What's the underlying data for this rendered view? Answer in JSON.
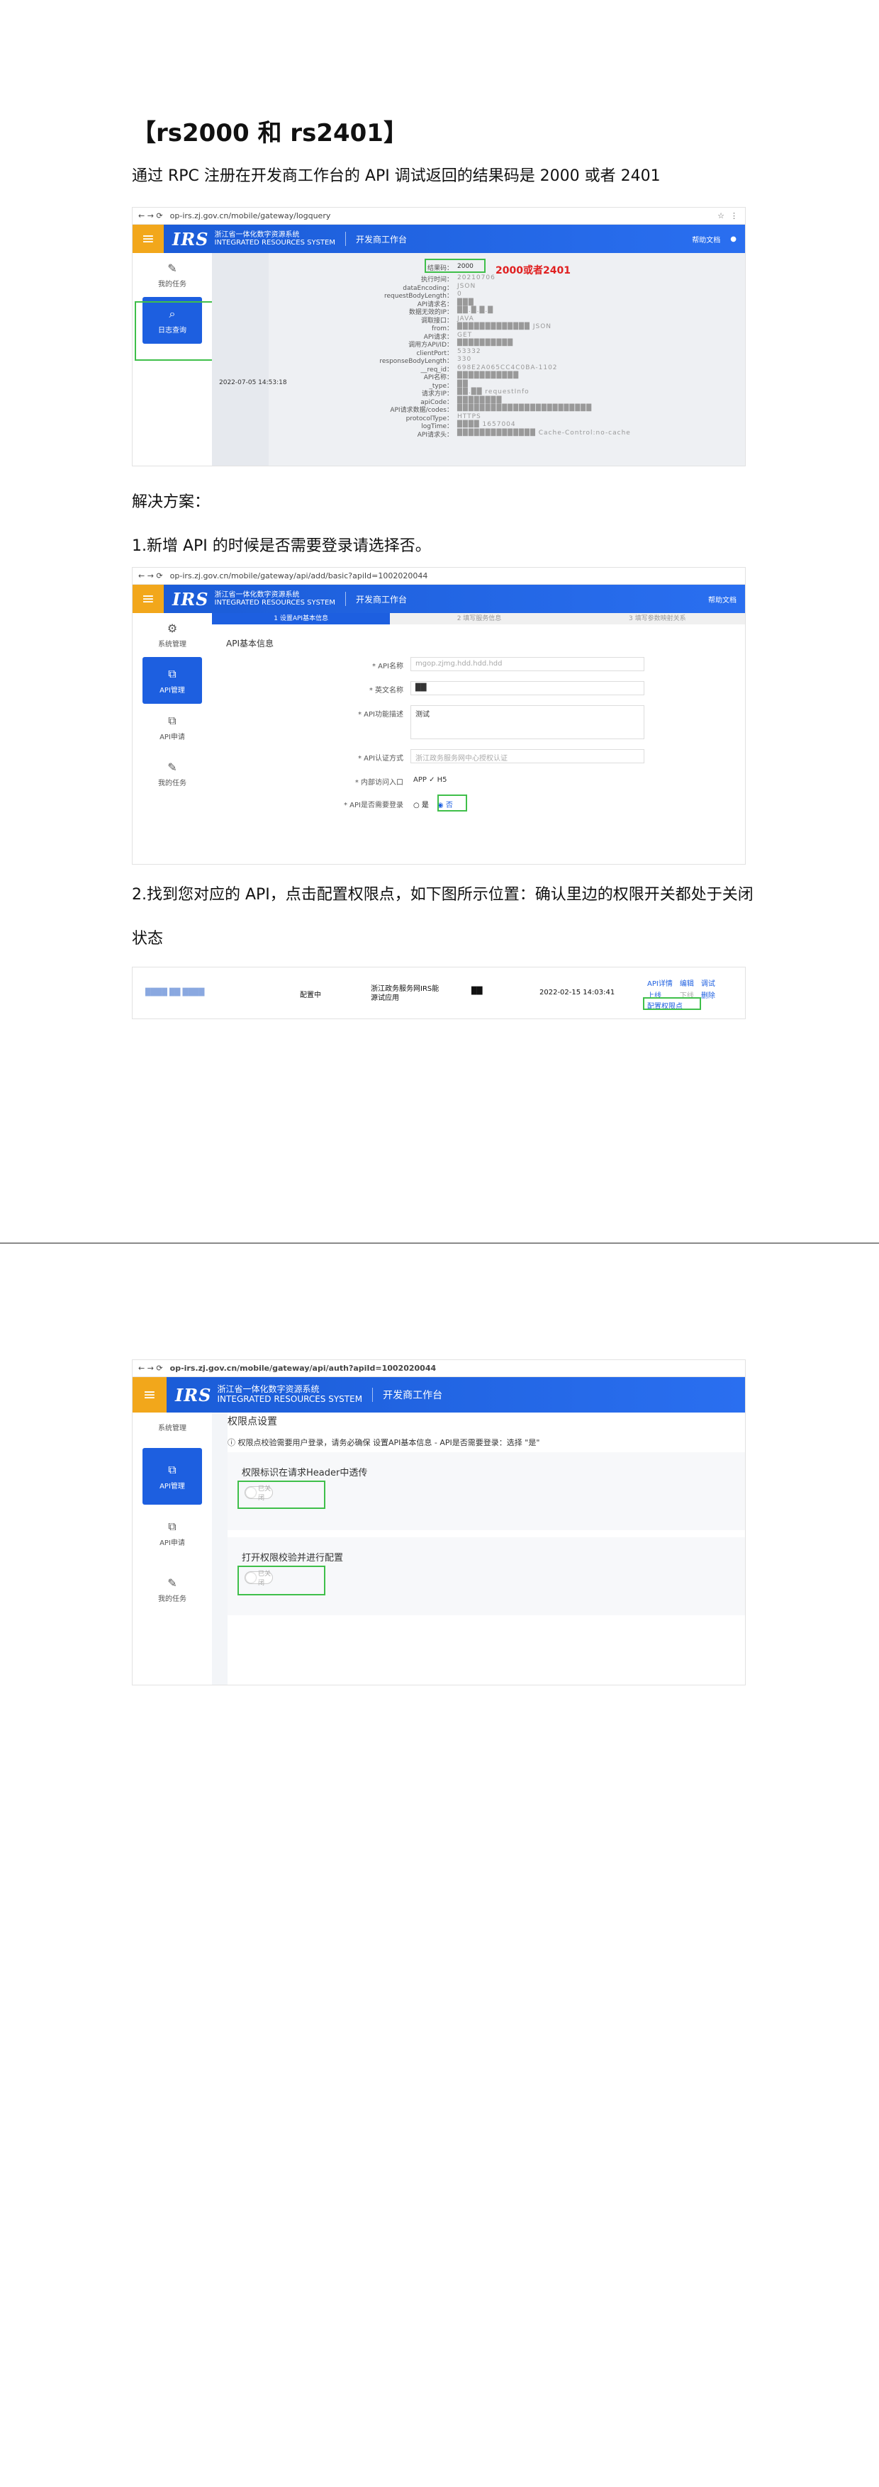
{
  "title": "【rs2000 和 rs2401】",
  "intro": "通过 RPC 注册在开发商工作台的 API  调试返回的结果码是 2000 或者 2401",
  "solution_heading": "解决方案：",
  "step1": "1.新增 API 的时候是否需要登录请选择否。",
  "step2_line1": "2.找到您对应的 API，点击配置权限点，如下图所示位置：确认里边的权限开关都处于关闭",
  "step2_line2": "状态",
  "app": {
    "logo": "IRS",
    "logo_cn": "浙江省一体化数字资源系统",
    "logo_en": "INTEGRATED RESOURCES SYSTEM",
    "name": "开发商工作台",
    "help": "帮助文档"
  },
  "shot1": {
    "url": "op-irs.zj.gov.cn/mobile/gateway/logquery",
    "side_items": [
      "我的任务",
      "日志查询"
    ],
    "annotation": "2000或者2401",
    "result_code_label": "结果码：",
    "result_code": "2000",
    "time": "2022-07-05 14:53:18",
    "rows": [
      {
        "k": "执行时间：",
        "v": "20210706"
      },
      {
        "k": "dataEncoding：",
        "v": "JSON"
      },
      {
        "k": "requestBodyLength：",
        "v": "0"
      },
      {
        "k": "API请求名：",
        "v": "███"
      },
      {
        "k": "数据无效的IP：",
        "v": "██.█.█.█"
      },
      {
        "k": "调取接口：",
        "v": "JAVA"
      },
      {
        "k": "from：",
        "v": "█████████████ JSON"
      },
      {
        "k": "API请求：",
        "v": "GET"
      },
      {
        "k": "调用方API/ID：",
        "v": "██████████"
      },
      {
        "k": "clientPort：",
        "v": "53332"
      },
      {
        "k": "responseBodyLength：",
        "v": "330"
      },
      {
        "k": "__req_id：",
        "v": "698E2A065CC4C0BA-1102"
      },
      {
        "k": "API名称：",
        "v": "███████████"
      },
      {
        "k": "_type：",
        "v": "██"
      },
      {
        "k": "请求方IP：",
        "v": "██.██  requestInfo"
      },
      {
        "k": "apiCode：",
        "v": "████████"
      },
      {
        "k": "API请求数据/codes：",
        "v": "████████████████████████"
      },
      {
        "k": "protocolType：",
        "v": "HTTPS"
      },
      {
        "k": "logTime：",
        "v": "████ 1657004"
      },
      {
        "k": "API请求头：",
        "v": "██████████████ Cache-Control:no-cache"
      }
    ]
  },
  "shot2": {
    "url": "op-irs.zj.gov.cn/mobile/gateway/api/add/basic?apiId=1002020044",
    "steps": [
      "1 设置API基本信息",
      "2 填写服务信息",
      "3 填写参数映射关系"
    ],
    "side_items": [
      "系统管理",
      "API管理",
      "API申请",
      "我的任务"
    ],
    "section": "API基本信息",
    "fields": [
      {
        "label": "* API名称",
        "value": "",
        "placeholder": "mgop.zjmg.hdd.hdd.hdd"
      },
      {
        "label": "* 英文名称",
        "value": "██",
        "placeholder": ""
      },
      {
        "label": "* API功能描述",
        "value": "测试",
        "placeholder": ""
      },
      {
        "label": "* API认证方式",
        "value": "",
        "placeholder": "浙江政务服务网中心授权认证"
      },
      {
        "label": "* 内部访问入口",
        "value": "APP  ✓ H5",
        "placeholder": ""
      },
      {
        "label": "* API是否需要登录",
        "value": "",
        "placeholder": ""
      }
    ],
    "login_options": [
      "是",
      "否"
    ]
  },
  "shot3": {
    "row_name": "████ ██ ████",
    "status": "配置中",
    "org": "浙江政务服务网IRS能源试应用",
    "time": "2022-02-15 14:03:41",
    "actions": [
      "API详情",
      "编辑",
      "调试",
      "上线",
      "下线",
      "删除"
    ],
    "config_link": "配置权限点"
  },
  "shot4": {
    "url": "op-irs.zj.gov.cn/mobile/gateway/api/auth?apiId=1002020044",
    "side_items": [
      "系统管理",
      "API管理",
      "API申请",
      "我的任务"
    ],
    "title": "权限点设置",
    "notice": "权限点校验需要用户登录，请务必确保 设置API基本信息 - API是否需要登录：选择 \"是\"",
    "section1": "权限标识在请求Header中透传",
    "section2": "打开权限校验并进行配置",
    "toggle_label": "已关闭"
  }
}
